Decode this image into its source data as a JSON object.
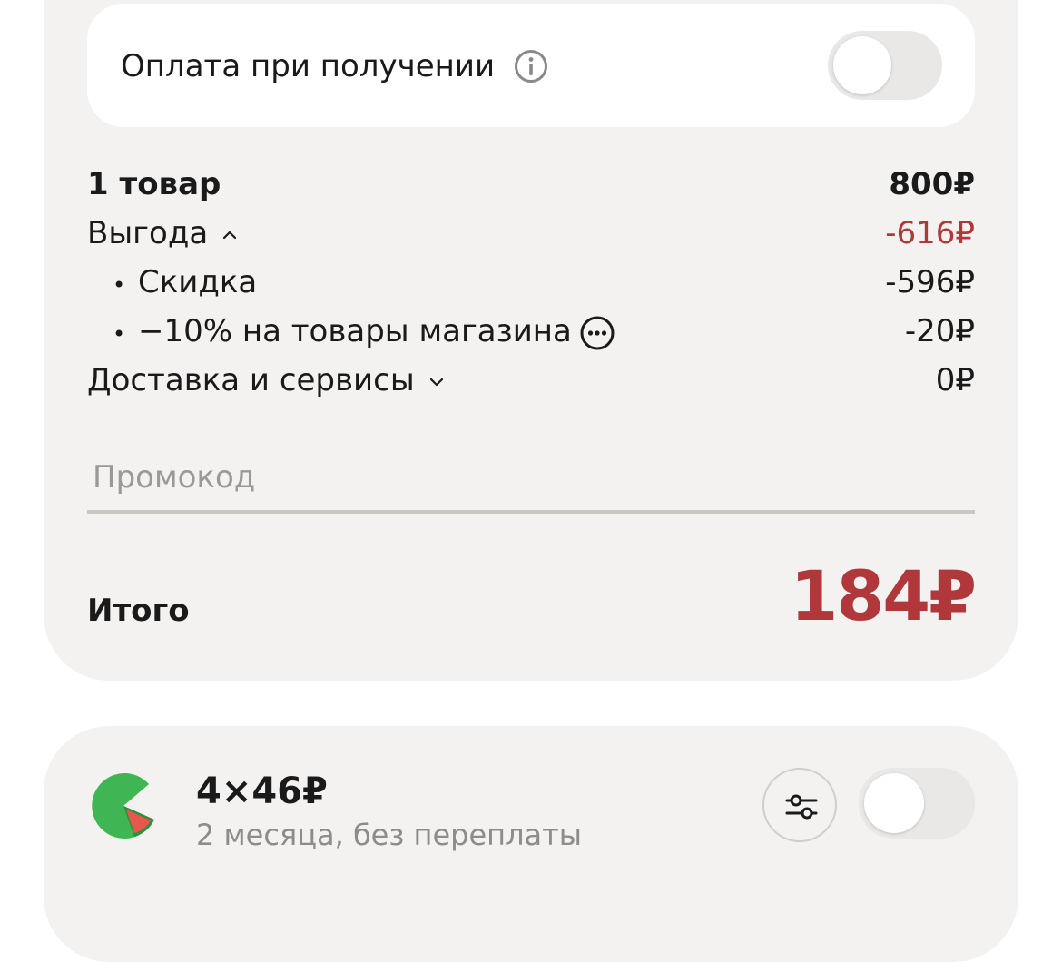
{
  "cash_on_delivery": {
    "label": "Оплата при получении",
    "enabled": false,
    "info_icon": "info-icon"
  },
  "summary": {
    "items_label": "1 товар",
    "items_value": "800₽",
    "benefit_label": "Выгода",
    "benefit_value": "-616₽",
    "discount_label": "Скидка",
    "discount_value": "-596₽",
    "shop_discount_label": "−10% на товары магазина",
    "shop_discount_value": "-20₽",
    "delivery_label": "Доставка и сервисы",
    "delivery_value": "0₽",
    "bullet": "•"
  },
  "promo": {
    "placeholder": "Промокод",
    "value": ""
  },
  "total": {
    "label": "Итого",
    "value": "184₽"
  },
  "split": {
    "amount": "4×46₽",
    "subtitle": "2 месяца, без переплаты",
    "enabled": false
  },
  "colors": {
    "accent_red": "#b0373a",
    "card_bg": "#f3f2f1",
    "split_green": "#3fb653"
  }
}
